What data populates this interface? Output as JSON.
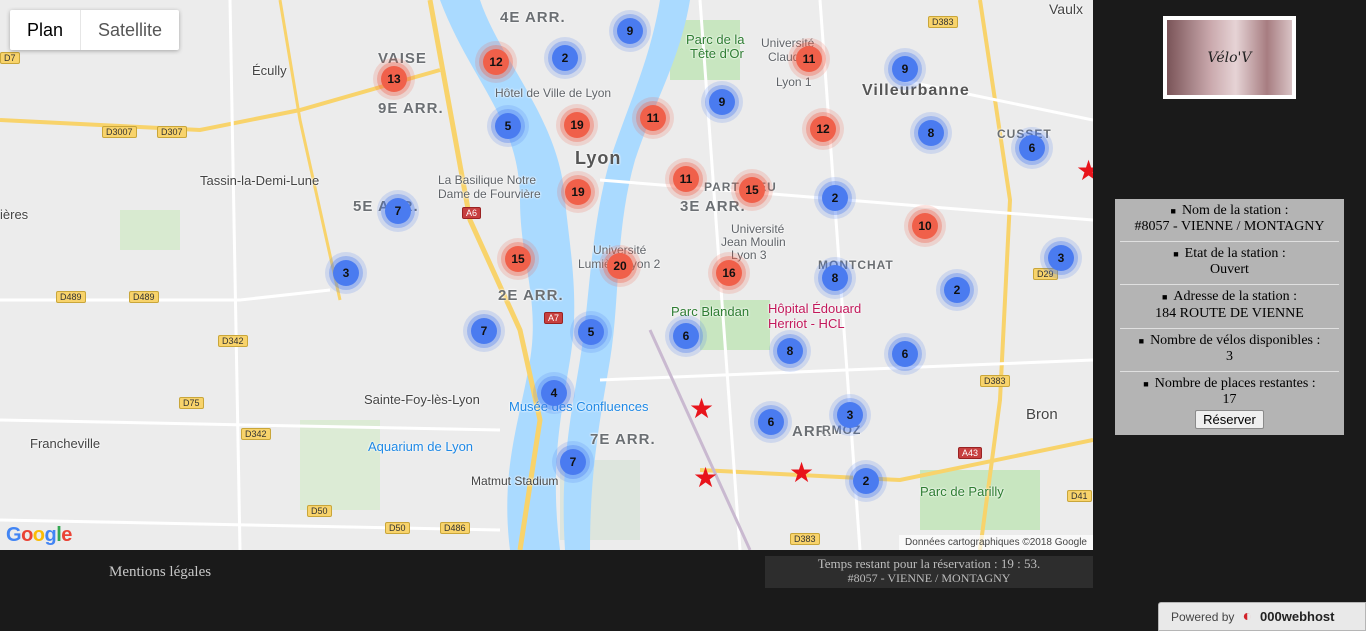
{
  "map": {
    "type_controls": {
      "plan": "Plan",
      "satellite": "Satellite"
    },
    "attribution": "Données cartographiques ©2018 Google",
    "google_logo": [
      "G",
      "o",
      "o",
      "g",
      "l",
      "e"
    ],
    "google_colors": [
      "#4285F4",
      "#EA4335",
      "#FBBC05",
      "#4285F4",
      "#34A853",
      "#EA4335"
    ],
    "labels": {
      "vaise": "VAISE",
      "arr9": "9E ARR.",
      "arr4": "4E ARR.",
      "arr5": "5E ARR.",
      "arr2": "2E ARR.",
      "arr3": "3E ARR.",
      "arr7": "7E ARR.",
      "arr8": "ARR.",
      "lyon": "Lyon",
      "villeurbanne": "Villeurbanne",
      "ecully": "Écully",
      "tassin": "Tassin-la-Demi-Lune",
      "sainte_foy": "Sainte-Foy-lès-Lyon",
      "francheville": "Francheville",
      "bron": "Bron",
      "vaulx": "Vaulx",
      "cusset": "CUSSET",
      "montchat": "MONTCHAT",
      "hotel_ville": "Hôtel de Ville de Lyon",
      "basilique": "La Basilique Notre",
      "basilique2": "Dame de Fourvière",
      "univ_lumiere": "Université",
      "univ_lumiere2": "Lumière Lyon 2",
      "univ_moulin": "Université",
      "univ_moulin2": "Jean Moulin",
      "univ_moulin3": "Lyon 3",
      "parc_blandan": "Parc Blandan",
      "hopital": "Hôpital Édouard",
      "hopital2": "Herriot - HCL",
      "confluences": "Musée des Confluences",
      "aquarium": "Aquarium de Lyon",
      "matmut": "Matmut Stadium",
      "parilly": "Parc de Parilly",
      "tete_or": "Parc de la",
      "tete_or2": "Tête d'Or",
      "univ_claude": "Université",
      "univ_claude2": "Claude",
      "univ_claude3": "Lyon 1",
      "part_dieu": "PART-DIEU",
      "mermoz": "RMOZ",
      "ieres": "ières"
    },
    "shields": {
      "d3007": "D3007",
      "d307": "D307",
      "d489a": "D489",
      "d489b": "D489",
      "d342": "D342",
      "d75": "D75",
      "d342b": "D342",
      "d50": "D50",
      "d50b": "D50",
      "d486": "D486",
      "a6": "A6",
      "a7": "A7",
      "d383a": "D383",
      "d383b": "D383",
      "d383c": "D383",
      "d29": "D29",
      "d41": "D41",
      "a43": "A43",
      "d7": "D7"
    },
    "clusters": [
      {
        "id": "c1",
        "count": "9",
        "color": "blue"
      },
      {
        "id": "c2",
        "count": "12",
        "color": "red"
      },
      {
        "id": "c3",
        "count": "2",
        "color": "blue"
      },
      {
        "id": "c4",
        "count": "13",
        "color": "red"
      },
      {
        "id": "c5",
        "count": "11",
        "color": "red"
      },
      {
        "id": "c6",
        "count": "9",
        "color": "blue"
      },
      {
        "id": "c7",
        "count": "5",
        "color": "blue"
      },
      {
        "id": "c8",
        "count": "19",
        "color": "red"
      },
      {
        "id": "c9",
        "count": "11",
        "color": "red"
      },
      {
        "id": "c10",
        "count": "9",
        "color": "blue"
      },
      {
        "id": "c11",
        "count": "12",
        "color": "red"
      },
      {
        "id": "c12",
        "count": "8",
        "color": "blue"
      },
      {
        "id": "c13",
        "count": "6",
        "color": "blue"
      },
      {
        "id": "c14",
        "count": "19",
        "color": "red"
      },
      {
        "id": "c15",
        "count": "11",
        "color": "red"
      },
      {
        "id": "c16",
        "count": "15",
        "color": "red"
      },
      {
        "id": "c17",
        "count": "2",
        "color": "blue"
      },
      {
        "id": "c18",
        "count": "7",
        "color": "blue"
      },
      {
        "id": "c19",
        "count": "10",
        "color": "red"
      },
      {
        "id": "c20",
        "count": "15",
        "color": "red"
      },
      {
        "id": "c21",
        "count": "20",
        "color": "red"
      },
      {
        "id": "c22",
        "count": "16",
        "color": "red"
      },
      {
        "id": "c23",
        "count": "8",
        "color": "blue"
      },
      {
        "id": "c24",
        "count": "3",
        "color": "blue"
      },
      {
        "id": "c25",
        "count": "3",
        "color": "blue"
      },
      {
        "id": "c26",
        "count": "2",
        "color": "blue"
      },
      {
        "id": "c27",
        "count": "7",
        "color": "blue"
      },
      {
        "id": "c28",
        "count": "5",
        "color": "blue"
      },
      {
        "id": "c29",
        "count": "6",
        "color": "blue"
      },
      {
        "id": "c30",
        "count": "8",
        "color": "blue"
      },
      {
        "id": "c31",
        "count": "6",
        "color": "blue"
      },
      {
        "id": "c32",
        "count": "4",
        "color": "blue"
      },
      {
        "id": "c33",
        "count": "3",
        "color": "blue"
      },
      {
        "id": "c34",
        "count": "6",
        "color": "blue"
      },
      {
        "id": "c35",
        "count": "7",
        "color": "blue"
      },
      {
        "id": "c36",
        "count": "2",
        "color": "blue"
      }
    ],
    "star_markers_count": 4
  },
  "logo": {
    "text": "Vélo'V"
  },
  "station": {
    "name_label": "Nom de la station :",
    "name_value": "#8057 - VIENNE / MONTAGNY",
    "state_label": "Etat de la station :",
    "state_value": "Ouvert",
    "address_label": "Adresse de la station :",
    "address_value": "184 ROUTE DE VIENNE",
    "bikes_label": "Nombre de vélos disponibles :",
    "bikes_value": "3",
    "places_label": "Nombre de places restantes :",
    "places_value": "17",
    "reserve_button": "Réserver"
  },
  "footer": {
    "legal_link": "Mentions légales",
    "timer_text": "Temps restant pour la réservation : 19 : 53.",
    "timer_station": "#8057 - VIENNE / MONTAGNY"
  },
  "powered": {
    "prefix": "Powered by",
    "brand": "000webhost"
  },
  "colors": {
    "accent_blue": "#4a7bf0",
    "accent_red": "#f0604a",
    "star": "#e8141b"
  }
}
